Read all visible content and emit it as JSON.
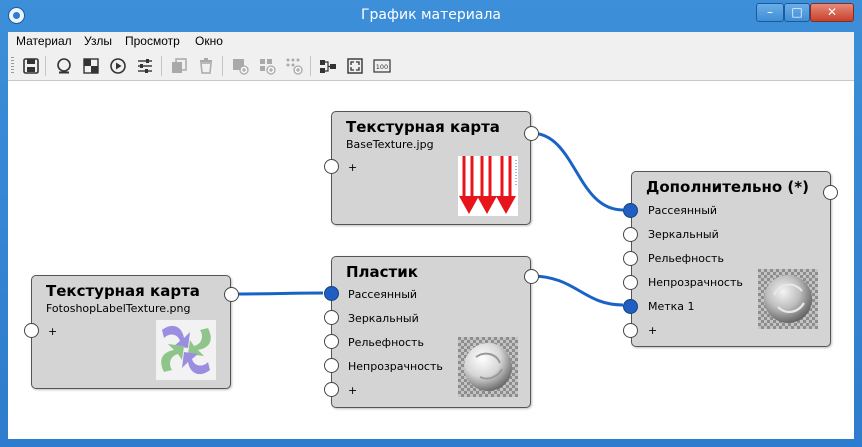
{
  "window": {
    "title": "График материала",
    "min_glyph": "–",
    "max_glyph": "□",
    "close_glyph": "✕"
  },
  "menu": [
    "Материал",
    "Узлы",
    "Просмотр",
    "Окно"
  ],
  "toolbar": {
    "icons": [
      {
        "name": "save-icon",
        "enabled": true
      },
      {
        "name": "sphere-preview-icon",
        "enabled": true
      },
      {
        "name": "checker-background-icon",
        "enabled": true
      },
      {
        "name": "play-icon",
        "enabled": true
      },
      {
        "name": "settings-sliders-icon",
        "enabled": true
      },
      {
        "name": "duplicate-icon",
        "enabled": false
      },
      {
        "name": "delete-icon",
        "enabled": false
      },
      {
        "name": "add-input-icon",
        "enabled": false
      },
      {
        "name": "add-group-icon",
        "enabled": false
      },
      {
        "name": "add-dots-icon",
        "enabled": false
      },
      {
        "name": "arrange-nodes-icon",
        "enabled": true
      },
      {
        "name": "fit-view-icon",
        "enabled": true
      },
      {
        "name": "zoom-100-icon",
        "enabled": true
      }
    ],
    "zoom_100_label": "100"
  },
  "colors": {
    "link": "#1a63c6",
    "port_connected": "#1f5fc4",
    "node_bg": "#d4d4d4"
  },
  "nodes": {
    "texture_base": {
      "title": "Текстурная карта",
      "file": "BaseTexture.jpg",
      "add_label": "+"
    },
    "texture_label": {
      "title": "Текстурная карта",
      "file": "FotoshopLabelTexture.png",
      "add_label": "+"
    },
    "plastic": {
      "title": "Пластик",
      "inputs": [
        "Рассеянный",
        "Зеркальный",
        "Рельефность",
        "Непрозрачность",
        "+"
      ]
    },
    "additional": {
      "title": "Дополнительно (*)",
      "inputs": [
        "Рассеянный",
        "Зеркальный",
        "Рельефность",
        "Непрозрачность",
        "Метка 1",
        "+"
      ]
    }
  }
}
